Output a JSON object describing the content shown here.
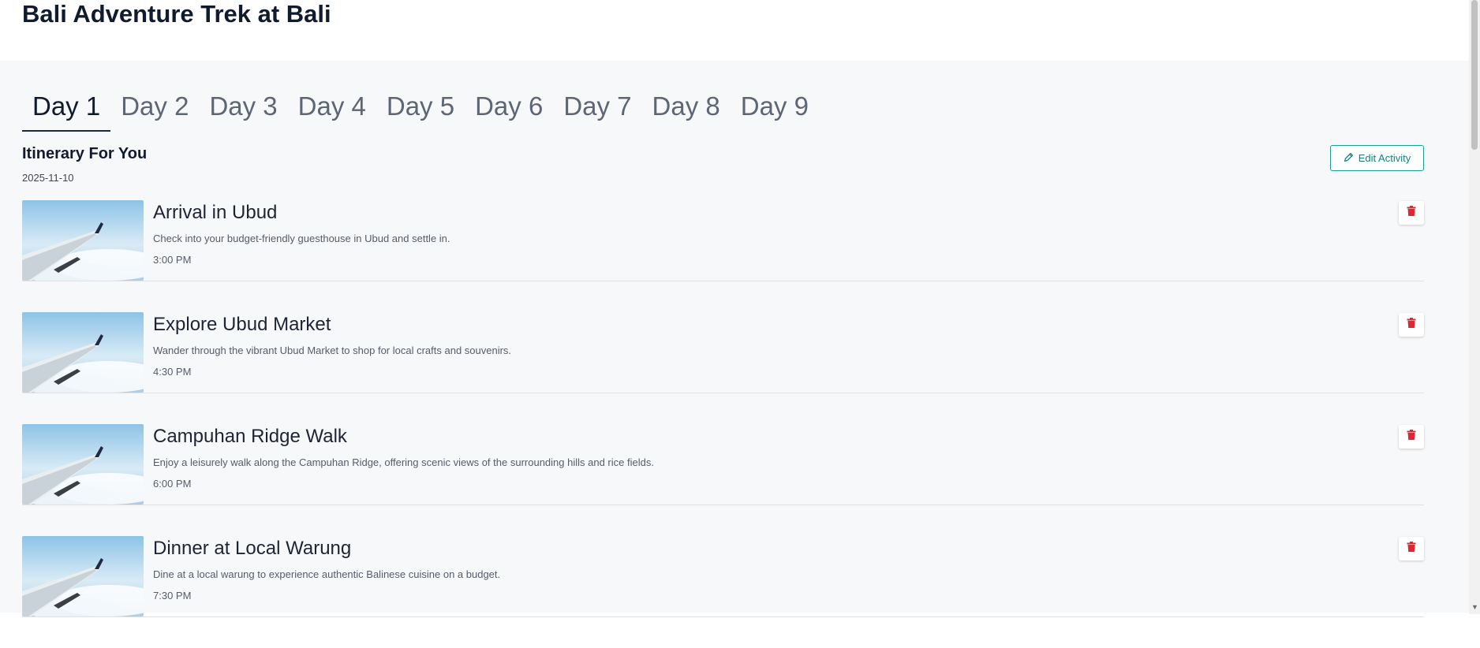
{
  "page": {
    "title": "Bali Adventure Trek at Bali"
  },
  "tabs": [
    {
      "label": "Day 1"
    },
    {
      "label": "Day 2"
    },
    {
      "label": "Day 3"
    },
    {
      "label": "Day 4"
    },
    {
      "label": "Day 5"
    },
    {
      "label": "Day 6"
    },
    {
      "label": "Day 7"
    },
    {
      "label": "Day 8"
    },
    {
      "label": "Day 9"
    }
  ],
  "active_tab": "Day 1",
  "itinerary": {
    "title": "Itinerary For You",
    "date": "2025-11-10",
    "edit_label": "Edit Activity"
  },
  "activities": [
    {
      "title": "Arrival in Ubud",
      "description": "Check into your budget-friendly guesthouse in Ubud and settle in.",
      "time": "3:00 PM"
    },
    {
      "title": "Explore Ubud Market",
      "description": "Wander through the vibrant Ubud Market to shop for local crafts and souvenirs.",
      "time": "4:30 PM"
    },
    {
      "title": "Campuhan Ridge Walk",
      "description": "Enjoy a leisurely walk along the Campuhan Ridge, offering scenic views of the surrounding hills and rice fields.",
      "time": "6:00 PM"
    },
    {
      "title": "Dinner at Local Warung",
      "description": "Dine at a local warung to experience authentic Balinese cuisine on a budget.",
      "time": "7:30 PM"
    }
  ],
  "icons": {
    "edit": "pencil-icon",
    "delete": "trash-icon"
  },
  "colors": {
    "accent": "#1c9c92",
    "delete": "#e0262f",
    "active_tab": "#111b2e",
    "inactive_tab": "#5d6675"
  }
}
